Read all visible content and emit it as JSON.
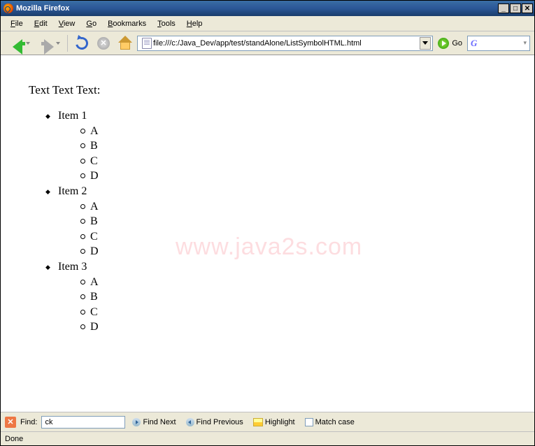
{
  "window": {
    "title": "Mozilla Firefox"
  },
  "menubar": {
    "items": [
      {
        "u": "F",
        "rest": "ile"
      },
      {
        "u": "E",
        "rest": "dit"
      },
      {
        "u": "V",
        "rest": "iew"
      },
      {
        "u": "G",
        "rest": "o"
      },
      {
        "u": "B",
        "rest": "ookmarks"
      },
      {
        "u": "T",
        "rest": "ools"
      },
      {
        "u": "H",
        "rest": "elp"
      }
    ]
  },
  "toolbar": {
    "url": "file:///c:/Java_Dev/app/test/standAlone/ListSymbolHTML.html",
    "go_label": "Go"
  },
  "page": {
    "heading": "Text Text Text:",
    "items": [
      {
        "label": "Item 1",
        "sub": [
          "A",
          "B",
          "C",
          "D"
        ]
      },
      {
        "label": "Item 2",
        "sub": [
          "A",
          "B",
          "C",
          "D"
        ]
      },
      {
        "label": "Item 3",
        "sub": [
          "A",
          "B",
          "C",
          "D"
        ]
      }
    ],
    "watermark": "www.java2s.com"
  },
  "findbar": {
    "label": "Find:",
    "value": "ck",
    "next": "Find Next",
    "prev": "Find Previous",
    "highlight": "Highlight",
    "matchcase": "Match case"
  },
  "status": {
    "text": "Done"
  }
}
